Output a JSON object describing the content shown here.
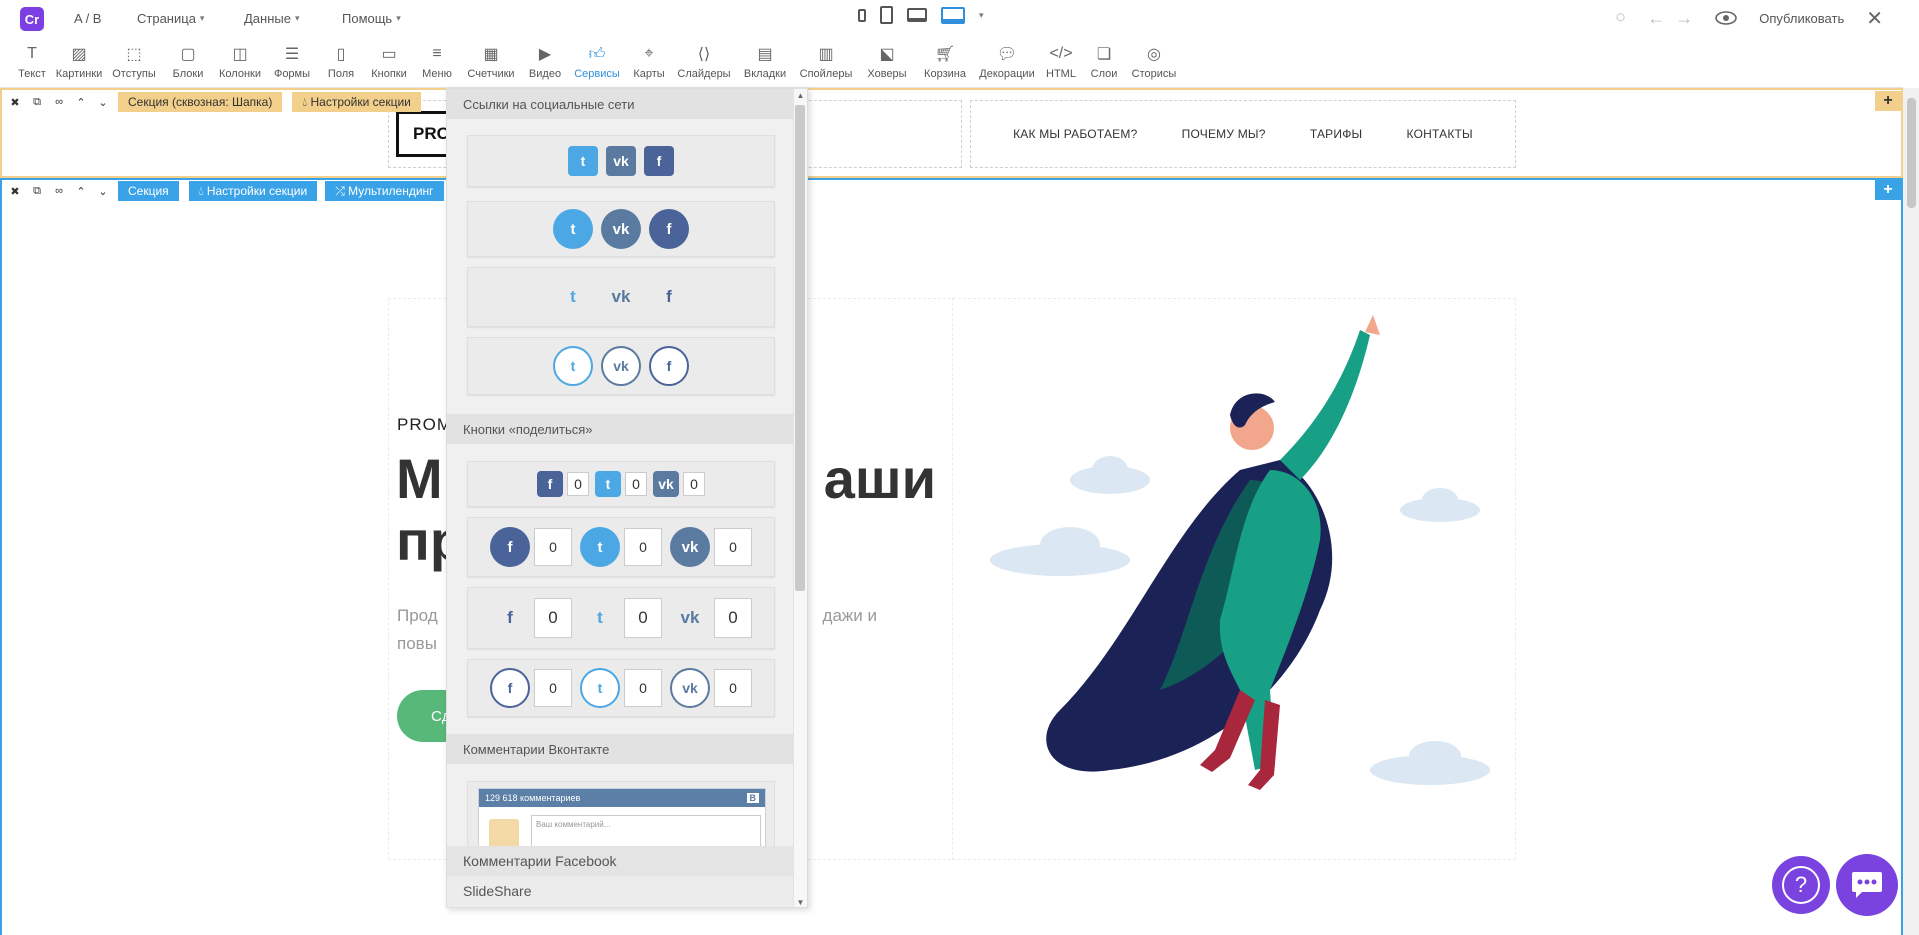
{
  "topbar": {
    "logo_text": "Cr",
    "ab_label": "A / B",
    "menu": [
      {
        "label": "Страница"
      },
      {
        "label": "Данные"
      },
      {
        "label": "Помощь"
      }
    ],
    "publish_label": "Опубликовать"
  },
  "toolbar": {
    "tools": [
      {
        "label": "Текст",
        "icon": "text-icon"
      },
      {
        "label": "Картинки",
        "icon": "image-icon"
      },
      {
        "label": "Отступы",
        "icon": "spacing-icon"
      },
      {
        "label": "Блоки",
        "icon": "block-icon"
      },
      {
        "label": "Колонки",
        "icon": "columns-icon"
      },
      {
        "label": "Формы",
        "icon": "forms-icon"
      },
      {
        "label": "Поля",
        "icon": "fields-icon"
      },
      {
        "label": "Кнопки",
        "icon": "button-icon"
      },
      {
        "label": "Меню",
        "icon": "menu-icon"
      },
      {
        "label": "Счетчики",
        "icon": "counter-icon"
      },
      {
        "label": "Видео",
        "icon": "video-icon"
      },
      {
        "label": "Сервисы",
        "icon": "thumbs-up-icon",
        "active": true
      },
      {
        "label": "Карты",
        "icon": "map-pin-icon"
      },
      {
        "label": "Слайдеры",
        "icon": "slider-icon"
      },
      {
        "label": "Вкладки",
        "icon": "tabs-icon"
      },
      {
        "label": "Спойлеры",
        "icon": "spoiler-icon"
      },
      {
        "label": "Ховеры",
        "icon": "hover-icon"
      },
      {
        "label": "Корзина",
        "icon": "cart-icon"
      },
      {
        "label": "Декорации",
        "icon": "speech-bubble-icon"
      },
      {
        "label": "HTML",
        "icon": "code-icon"
      },
      {
        "label": "Слои",
        "icon": "layers-icon"
      },
      {
        "label": "Сторисы",
        "icon": "stories-icon"
      }
    ],
    "active_color": "#2f8fdc"
  },
  "header_section": {
    "label": "Секция (сквозная: Шапка)",
    "settings_label": "Настройки секции",
    "accent": "#f2cf8a",
    "logo_text": "PRO",
    "nav": [
      "КАК МЫ РАБОТАЕМ?",
      "ПОЧЕМУ МЫ?",
      "ТАРИФЫ",
      "КОНТАКТЫ"
    ]
  },
  "main_section": {
    "label": "Секция",
    "settings_label": "Настройки секции",
    "multilanding_label": "Мультилендинг",
    "accent": "#3aa3e8",
    "eyebrow": "PROM",
    "headline_line1": "М",
    "headline_line1_end": "аши",
    "headline_line2": "пр",
    "subtext_start": "Прод",
    "subtext_end": "дажи и",
    "subtext_line2": "повы",
    "cta_label": "Сд",
    "cta_color": "#58b879"
  },
  "panel": {
    "sections": {
      "social_links": "Ссылки на социальные сети",
      "share_buttons": "Кнопки «поделиться»",
      "vk_comments": "Комментарии Вконтакте",
      "fb_comments": "Комментарии Facebook",
      "slideshare": "SlideShare"
    },
    "colors": {
      "twitter": "#4ca7e5",
      "vk": "#5a7aa0",
      "facebook": "#4a6399"
    },
    "share_count": "0",
    "vk_preview": {
      "count_label": "129 618 комментариев",
      "input_placeholder": "Ваш комментарий...",
      "badge": "B"
    }
  },
  "help": {
    "question": "?"
  }
}
